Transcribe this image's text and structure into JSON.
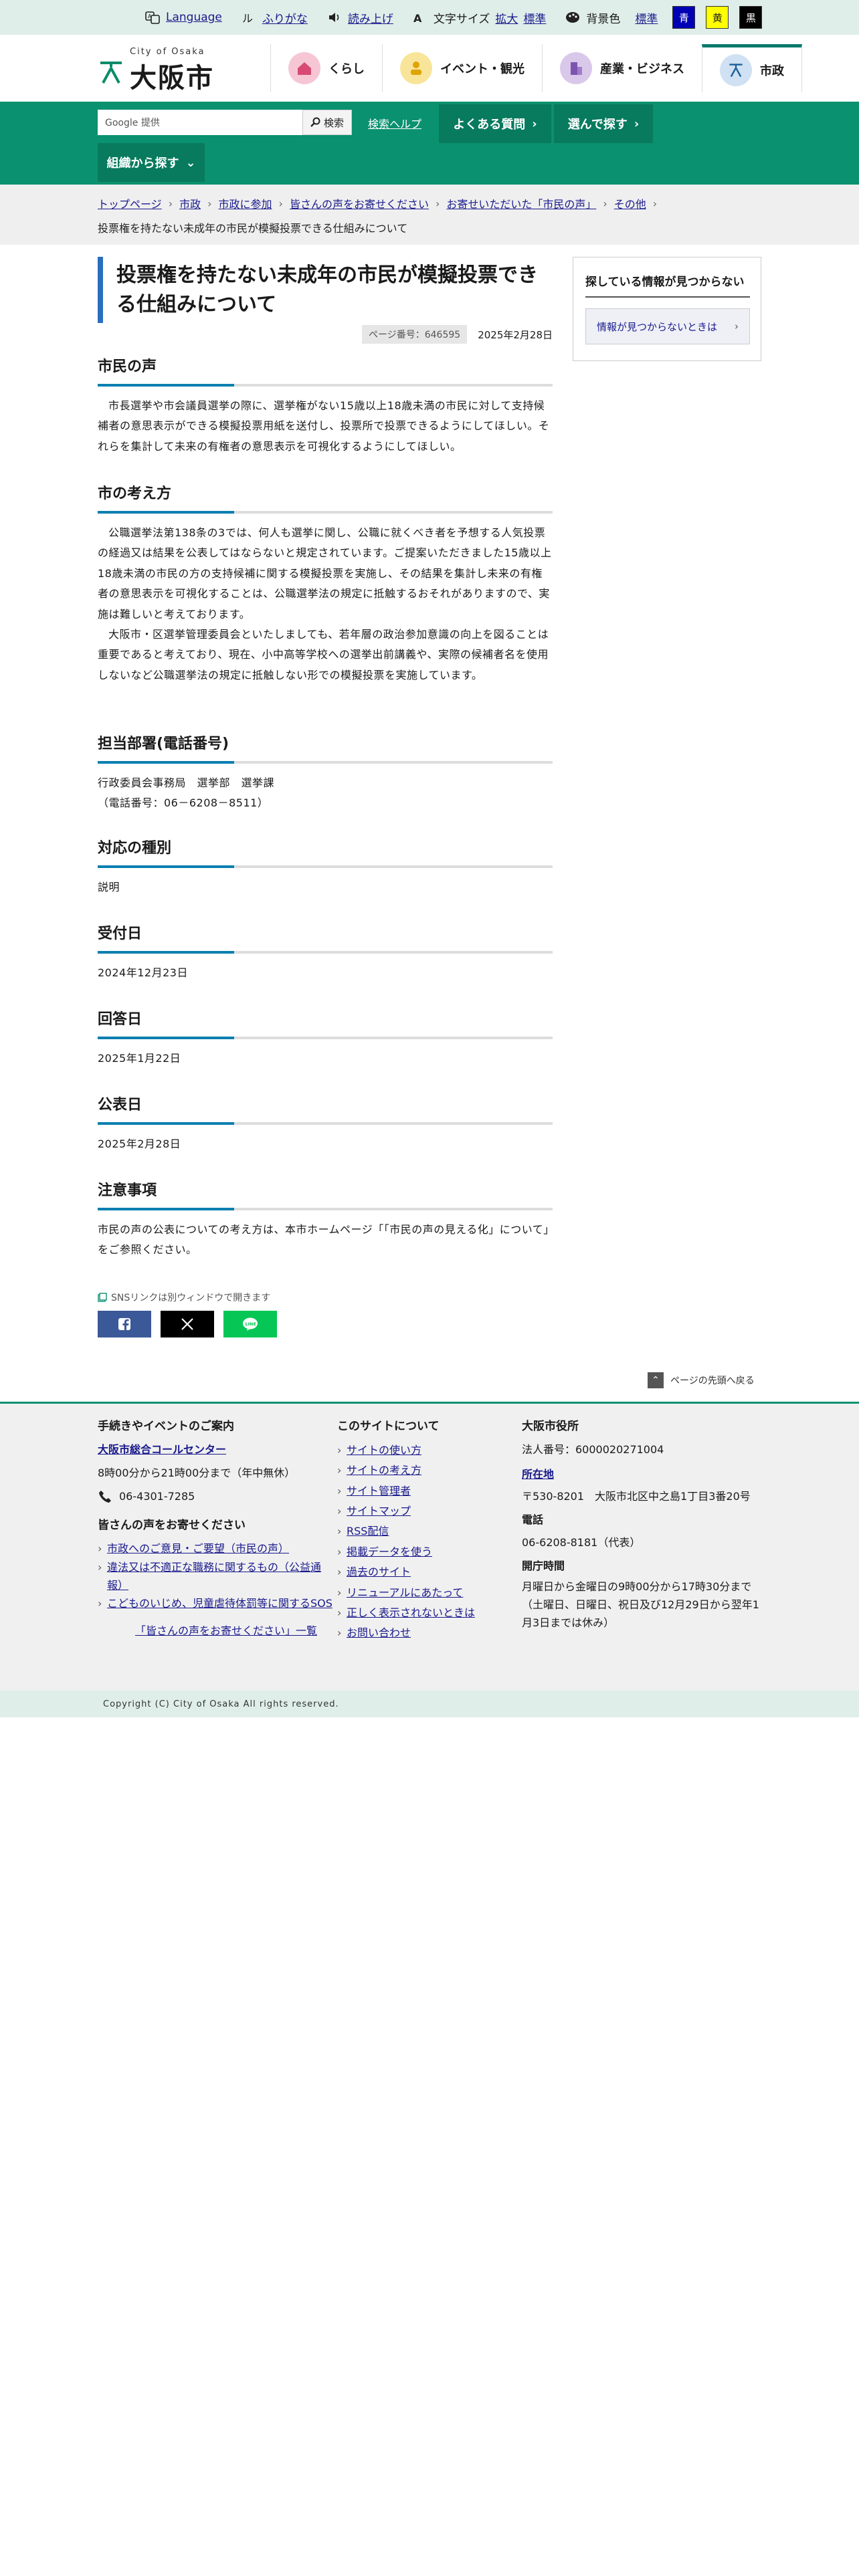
{
  "util": {
    "language": "Language",
    "furigana": "ふりがな",
    "readaloud": "読み上げ",
    "textsize_label": "文字サイズ",
    "textsize_large": "拡大",
    "textsize_normal": "標準",
    "bg_label": "背景色",
    "bg_standard": "標準",
    "bg_blue": "青",
    "bg_yellow": "黄",
    "bg_black": "黒"
  },
  "header": {
    "logo_en": "City of Osaka",
    "logo_jp": "大阪市",
    "nav": [
      {
        "label": "くらし",
        "icon": "house-icon",
        "color": "#f6c6d4"
      },
      {
        "label": "イベント・観光",
        "icon": "person-icon",
        "color": "#f9e59a"
      },
      {
        "label": "産業・ビジネス",
        "icon": "building-icon",
        "color": "#d9c8ea"
      },
      {
        "label": "市政",
        "icon": "city-emblem-icon",
        "color": "#cfe1f2"
      }
    ]
  },
  "greenbar": {
    "search_placeholder": "Google 提供",
    "search_button": "検索",
    "help": "検索ヘルプ",
    "faq": "よくある質問",
    "choose": "選んで探す",
    "org": "組織から探す"
  },
  "breadcrumb": {
    "items": [
      "トップページ",
      "市政",
      "市政に参加",
      "皆さんの声をお寄せください",
      "お寄せいただいた「市民の声」",
      "その他"
    ],
    "current": "投票権を持たない未成年の市民が模擬投票できる仕組みについて"
  },
  "main": {
    "title": "投票権を持たない未成年の市民が模擬投票できる仕組みについて",
    "page_number": "ページ番号：646595",
    "date": "2025年2月28日",
    "sections": [
      {
        "heading": "市民の声",
        "body": [
          "市長選挙や市会議員選挙の際に、選挙権がない15歳以上18歳未満の市民に対して支持候補者の意思表示ができる模擬投票用紙を送付し、投票所で投票できるようにしてほしい。それらを集計して未来の有権者の意思表示を可視化するようにしてほしい。"
        ]
      },
      {
        "heading": "市の考え方",
        "body": [
          "公職選挙法第138条の3では、何人も選挙に関し、公職に就くべき者を予想する人気投票の経過又は結果を公表してはならないと規定されています。ご提案いただきました15歳以上18歳未満の市民の方の支持候補に関する模擬投票を実施し、その結果を集計し未来の有権者の意思表示を可視化することは、公職選挙法の規定に抵触するおそれがありますので、実施は難しいと考えております。",
          "大阪市・区選挙管理委員会といたしましても、若年層の政治参加意識の向上を図ることは重要であると考えており、現在、小中高等学校への選挙出前講義や、実際の候補者名を使用しないなど公職選挙法の規定に抵触しない形での模擬投票を実施しています。"
        ]
      },
      {
        "heading": "担当部署(電話番号)",
        "body": [
          "行政委員会事務局　選挙部　選挙課",
          "（電話番号：06－6208－8511）"
        ]
      },
      {
        "heading": "対応の種別",
        "body": [
          "説明"
        ]
      },
      {
        "heading": "受付日",
        "body": [
          "2024年12月23日"
        ]
      },
      {
        "heading": "回答日",
        "body": [
          "2025年1月22日"
        ]
      },
      {
        "heading": "公表日",
        "body": [
          "2025年2月28日"
        ]
      },
      {
        "heading": "注意事項",
        "body": [
          "市民の声の公表についての考え方は、本市ホームページ「「市民の声の見える化」について」をご参照ください。"
        ]
      }
    ],
    "sns_note": "SNSリンクは別ウィンドウで開きます",
    "sns": [
      {
        "name": "facebook",
        "glyph": "f",
        "color": "#3b5998"
      },
      {
        "name": "x",
        "glyph": "𝕏",
        "color": "#000000"
      },
      {
        "name": "line",
        "glyph": "LINE",
        "color": "#06c755"
      }
    ]
  },
  "sidebar": {
    "heading": "探している情報が見つからない",
    "link": "情報が見つからないときは"
  },
  "totop": "ページの先頭へ戻る",
  "footer": {
    "col1": {
      "h1": "手続きやイベントのご案内",
      "callcenter": "大阪市総合コールセンター",
      "hours": "8時00分から21時00分まで（年中無休）",
      "phone": "06-4301-7285",
      "h2": "皆さんの声をお寄せください",
      "links": [
        "市政へのご意見・ご要望（市民の声）",
        "違法又は不適正な職務に関するもの（公益通報）",
        "こどものいじめ、児童虐待体罰等に関するSOS"
      ],
      "all": "「皆さんの声をお寄せください」一覧"
    },
    "col2": {
      "h": "このサイトについて",
      "links": [
        "サイトの使い方",
        "サイトの考え方",
        "サイト管理者",
        "サイトマップ",
        "RSS配信",
        "掲載データを使う",
        "過去のサイト",
        "リニューアルにあたって",
        "正しく表示されないときは",
        "お問い合わせ"
      ]
    },
    "col3": {
      "name": "大阪市役所",
      "corp": "法人番号：6000020271004",
      "address_label": "所在地",
      "address": "〒530-8201　大阪市北区中之島1丁目3番20号",
      "tel_label": "電話",
      "tel": "06-6208-8181（代表）",
      "hours_label": "開庁時間",
      "hours1": "月曜日から金曜日の9時00分から17時30分まで",
      "hours2": "（土曜日、日曜日、祝日及び12月29日から翌年1月3日までは休み）"
    },
    "copyright": "Copyright (C) City of Osaka All rights reserved."
  }
}
